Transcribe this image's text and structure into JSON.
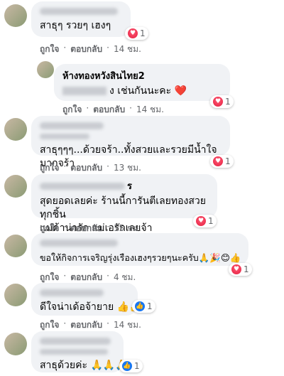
{
  "comments": [
    {
      "text": "สาธุๆ รวยๆ เฮงๆ",
      "react_count": "1",
      "like": "ถูกใจ",
      "reply": "ตอบกลับ",
      "time": "14 ชม."
    },
    {
      "name": "ห้างทองหวังสินไทย2",
      "text": "ง เช่นกันนะคะ ❤️",
      "react_count": "1",
      "like": "ถูกใจ",
      "reply": "ตอบกลับ",
      "time": "14 ชม."
    },
    {
      "text": "สาธุๆๆๆ...ด้วยจร้า..ทั้งสวยและรวยมีน้ำใจมากจร้า",
      "react_count": "1",
      "like": "ถูกใจ",
      "reply": "ตอบกลับ",
      "time": "13 ชม."
    },
    {
      "name_suffix": "ร",
      "text_line1": "สุดยอดเลยค่ะ ร้านนี้การันตีเลยทองสวยทุกชิ้น",
      "text_line2": "แม่ค้าน่ารัก แม่เอรักเลยจ้า",
      "react_count": "1",
      "like": "ถูกใจ",
      "reply": "ตอบกลับ",
      "time": "15 ชม."
    },
    {
      "text": "ขอให้กิจการเจริญรุ่งเรืองเฮงๆรวยๆนะครับ🙏🎉😊👍",
      "react_count": "1",
      "like": "ถูกใจ",
      "reply": "ตอบกลับ",
      "time": "4 ชม."
    },
    {
      "text": "ดีใจน่าเด้อจ้ายาย 👍👍",
      "react_count": "1",
      "like": "ถูกใจ",
      "reply": "ตอบกลับ",
      "time": "14 ชม."
    },
    {
      "text": "สาธุด้วยค่ะ 🙏🙏🙏",
      "react_count": "1"
    }
  ]
}
